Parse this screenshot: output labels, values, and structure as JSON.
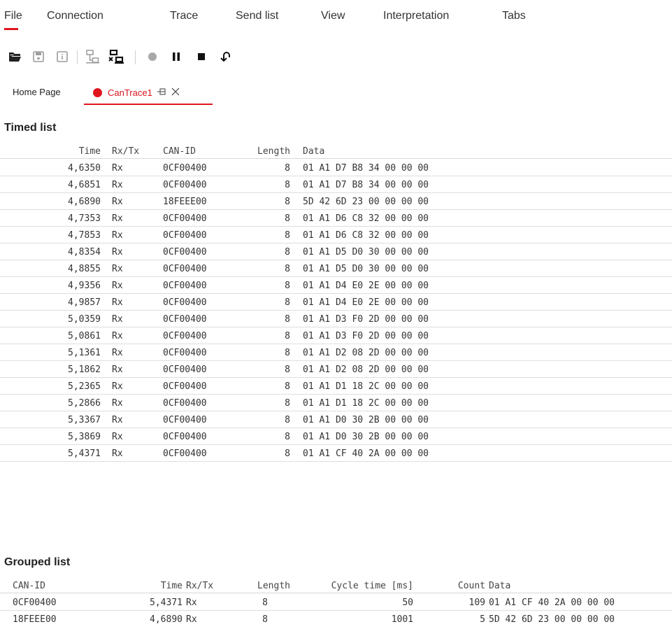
{
  "menu": [
    "File",
    "Connection",
    "Trace",
    "Send list",
    "View",
    "Interpretation",
    "Tabs"
  ],
  "toolbar": {
    "icons": [
      "folder-open-icon",
      "save-icon",
      "info-icon",
      "network-connect-icon",
      "network-disconnect-icon",
      "record-icon",
      "pause-icon",
      "stop-icon",
      "undo-icon"
    ],
    "accent_color": "#e0151e"
  },
  "tabs": {
    "home": "Home Page",
    "active": "CanTrace1",
    "active_color": "#e0151e"
  },
  "timed": {
    "title": "Timed list",
    "headers": {
      "time": "Time",
      "rxtx": "Rx/Tx",
      "id": "CAN-ID",
      "length": "Length",
      "data": "Data"
    },
    "rows": [
      {
        "time": "4,6350",
        "rxtx": "Rx",
        "id": "0CF00400",
        "length": "8",
        "data": "01 A1 D7 B8 34 00 00 00"
      },
      {
        "time": "4,6851",
        "rxtx": "Rx",
        "id": "0CF00400",
        "length": "8",
        "data": "01 A1 D7 B8 34 00 00 00"
      },
      {
        "time": "4,6890",
        "rxtx": "Rx",
        "id": "18FEEE00",
        "length": "8",
        "data": "5D 42 6D 23 00 00 00 00"
      },
      {
        "time": "4,7353",
        "rxtx": "Rx",
        "id": "0CF00400",
        "length": "8",
        "data": "01 A1 D6 C8 32 00 00 00"
      },
      {
        "time": "4,7853",
        "rxtx": "Rx",
        "id": "0CF00400",
        "length": "8",
        "data": "01 A1 D6 C8 32 00 00 00"
      },
      {
        "time": "4,8354",
        "rxtx": "Rx",
        "id": "0CF00400",
        "length": "8",
        "data": "01 A1 D5 D0 30 00 00 00"
      },
      {
        "time": "4,8855",
        "rxtx": "Rx",
        "id": "0CF00400",
        "length": "8",
        "data": "01 A1 D5 D0 30 00 00 00"
      },
      {
        "time": "4,9356",
        "rxtx": "Rx",
        "id": "0CF00400",
        "length": "8",
        "data": "01 A1 D4 E0 2E 00 00 00"
      },
      {
        "time": "4,9857",
        "rxtx": "Rx",
        "id": "0CF00400",
        "length": "8",
        "data": "01 A1 D4 E0 2E 00 00 00"
      },
      {
        "time": "5,0359",
        "rxtx": "Rx",
        "id": "0CF00400",
        "length": "8",
        "data": "01 A1 D3 F0 2D 00 00 00"
      },
      {
        "time": "5,0861",
        "rxtx": "Rx",
        "id": "0CF00400",
        "length": "8",
        "data": "01 A1 D3 F0 2D 00 00 00"
      },
      {
        "time": "5,1361",
        "rxtx": "Rx",
        "id": "0CF00400",
        "length": "8",
        "data": "01 A1 D2 08 2D 00 00 00"
      },
      {
        "time": "5,1862",
        "rxtx": "Rx",
        "id": "0CF00400",
        "length": "8",
        "data": "01 A1 D2 08 2D 00 00 00"
      },
      {
        "time": "5,2365",
        "rxtx": "Rx",
        "id": "0CF00400",
        "length": "8",
        "data": "01 A1 D1 18 2C 00 00 00"
      },
      {
        "time": "5,2866",
        "rxtx": "Rx",
        "id": "0CF00400",
        "length": "8",
        "data": "01 A1 D1 18 2C 00 00 00"
      },
      {
        "time": "5,3367",
        "rxtx": "Rx",
        "id": "0CF00400",
        "length": "8",
        "data": "01 A1 D0 30 2B 00 00 00"
      },
      {
        "time": "5,3869",
        "rxtx": "Rx",
        "id": "0CF00400",
        "length": "8",
        "data": "01 A1 D0 30 2B 00 00 00"
      },
      {
        "time": "5,4371",
        "rxtx": "Rx",
        "id": "0CF00400",
        "length": "8",
        "data": "01 A1 CF 40 2A 00 00 00"
      }
    ]
  },
  "grouped": {
    "title": "Grouped list",
    "headers": {
      "id": "CAN-ID",
      "time": "Time",
      "rxtx": "Rx/Tx",
      "length": "Length",
      "cycle": "Cycle time [ms]",
      "count": "Count",
      "data": "Data"
    },
    "rows": [
      {
        "id": "0CF00400",
        "time": "5,4371",
        "rxtx": "Rx",
        "length": "8",
        "cycle": "50",
        "count": "109",
        "data": "01 A1 CF 40 2A 00 00 00"
      },
      {
        "id": "18FEEE00",
        "time": "4,6890",
        "rxtx": "Rx",
        "length": "8",
        "cycle": "1001",
        "count": "5",
        "data": "5D 42 6D 23 00 00 00 00"
      }
    ]
  }
}
